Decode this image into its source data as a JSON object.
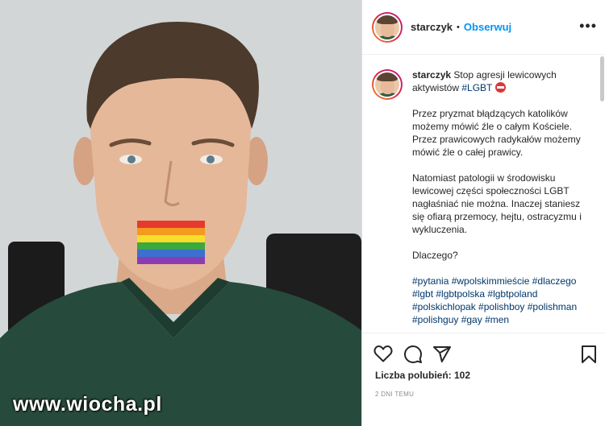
{
  "photo": {
    "watermark": "www.wiocha.pl"
  },
  "header": {
    "username": "starczyk",
    "separator": "•",
    "follow_label": "Obserwuj",
    "more_label": "•••"
  },
  "caption": {
    "username": "starczyk",
    "title": "Stop agresji lewicowych aktywistów",
    "title_tag": "#LGBT",
    "paragraphs": [
      "Przez pryzmat błądzących katolików możemy mówić źle o całym Kościele. Przez prawicowych radykałów możemy mówić źle o całej prawicy.",
      "Natomiast patologii w środowisku lewicowej części społeczności LGBT nagłaśniać nie można. Inaczej staniesz się ofiarą przemocy, hejtu, ostracyzmu i wykluczenia.",
      "Dlaczego?"
    ],
    "hashtags": "#pytania #wpolskimmieście #dlaczego #lgbt #lgbtpolska #lgbtpoland #polskichlopak #polishboy #polishman #polishguy #gay #men"
  },
  "icons": {
    "like": "heart-icon",
    "comment": "comment-icon",
    "share": "paper-plane-icon",
    "save": "bookmark-icon",
    "ban": "no-entry-icon"
  },
  "likes": {
    "label": "Liczba polubień: 102"
  },
  "time": {
    "label": "2 DNI TEMU"
  },
  "colors": {
    "link": "#0095f6",
    "hashtag": "#00376b",
    "meta": "#8e8e8e"
  }
}
